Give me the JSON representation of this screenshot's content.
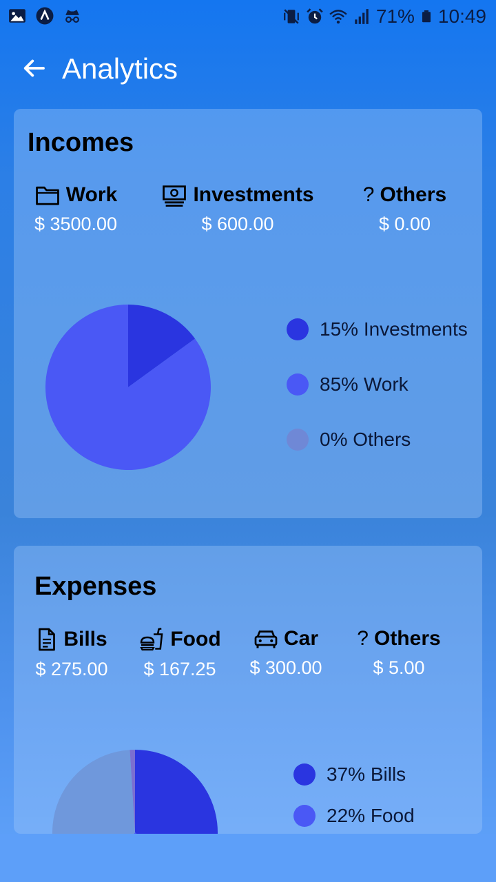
{
  "status_bar": {
    "battery": "71%",
    "time": "10:49",
    "icons": [
      "image-icon",
      "app-a-icon",
      "incognito-icon",
      "vibrate-icon",
      "alarm-icon",
      "wifi-icon",
      "signal-icon",
      "battery-icon"
    ]
  },
  "header": {
    "title": "Analytics"
  },
  "incomes": {
    "title": "Incomes",
    "categories": [
      {
        "label": "Work",
        "amount": "$ 3500.00",
        "icon": "folder-icon"
      },
      {
        "label": "Investments",
        "amount": "$ 600.00",
        "icon": "money-icon"
      },
      {
        "label": "Others",
        "amount": "$ 0.00",
        "icon": "question-icon"
      }
    ],
    "legend": [
      {
        "label": "15% Investments",
        "color": "#2a35e0"
      },
      {
        "label": "85% Work",
        "color": "#4a58f5"
      },
      {
        "label": "0% Others",
        "color": "#6f88d6"
      }
    ],
    "pie": [
      {
        "name": "Investments",
        "value": 15,
        "color": "#2a35e0"
      },
      {
        "name": "Work",
        "value": 85,
        "color": "#4a58f5"
      },
      {
        "name": "Others",
        "value": 0,
        "color": "#6f88d6"
      }
    ]
  },
  "expenses": {
    "title": "Expenses",
    "categories": [
      {
        "label": "Bills",
        "amount": "$ 275.00",
        "icon": "document-icon"
      },
      {
        "label": "Food",
        "amount": "$ 167.25",
        "icon": "fastfood-icon"
      },
      {
        "label": "Car",
        "amount": "$ 300.00",
        "icon": "car-icon"
      },
      {
        "label": "Others",
        "amount": "$ 5.00",
        "icon": "question-icon"
      }
    ],
    "legend": [
      {
        "label": "37% Bills",
        "color": "#2a35e0"
      },
      {
        "label": "22% Food",
        "color": "#4a58f5"
      }
    ],
    "pie": [
      {
        "name": "Bills",
        "value": 37,
        "color": "#2a35e0"
      },
      {
        "name": "Food",
        "value": 22,
        "color": "#4a58f5"
      },
      {
        "name": "Car",
        "value": 40,
        "color": "#6f98dc"
      },
      {
        "name": "Others",
        "value": 1,
        "color": "#7b6fd0"
      }
    ]
  },
  "colors": {
    "accent": "#1476f0",
    "card": "#a0c8fa",
    "amount_text": "#ffffff"
  }
}
